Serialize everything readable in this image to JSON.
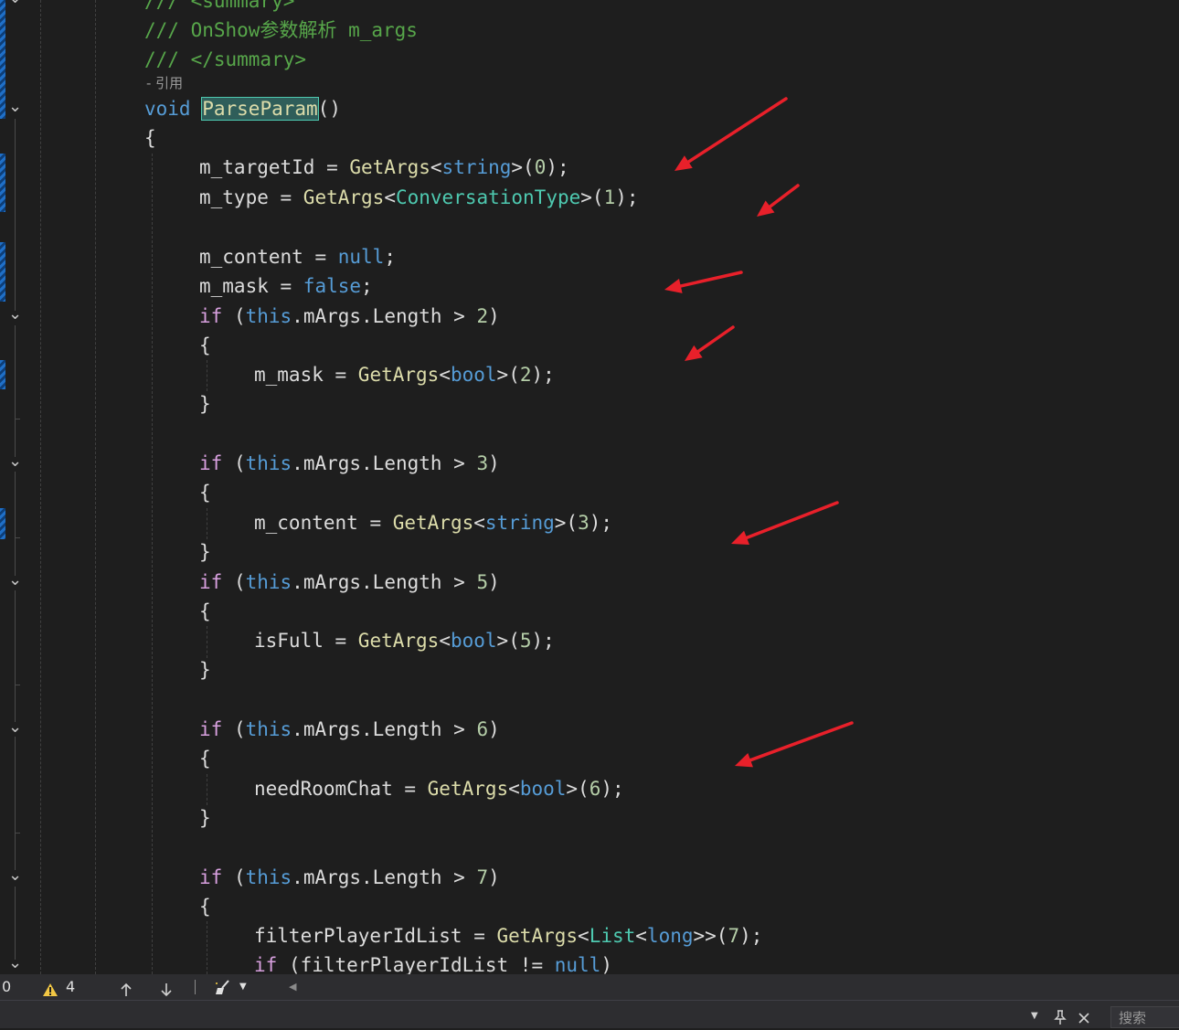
{
  "editor": {
    "codelens": "- 引用",
    "lines": [
      [
        [
          "k-comment",
          "/// <summary>"
        ]
      ],
      [
        [
          "k-comment",
          "/// OnShow参数解析 m_args"
        ]
      ],
      [
        [
          "k-comment",
          "/// </summary>"
        ]
      ],
      [
        [
          "k-keyword",
          "void"
        ],
        [
          "k-plain",
          " "
        ],
        [
          "k-hl",
          "ParseParam"
        ],
        [
          "k-plain",
          "()"
        ]
      ],
      [
        [
          "k-plain",
          "{"
        ]
      ],
      [
        [
          "k-var",
          "m_targetId"
        ],
        [
          "k-plain",
          " = "
        ],
        [
          "k-method",
          "GetArgs"
        ],
        [
          "k-plain",
          "<"
        ],
        [
          "k-keyword",
          "string"
        ],
        [
          "k-plain",
          ">("
        ],
        [
          "k-number",
          "0"
        ],
        [
          "k-plain",
          ");"
        ]
      ],
      [
        [
          "k-var",
          "m_type"
        ],
        [
          "k-plain",
          " = "
        ],
        [
          "k-method",
          "GetArgs"
        ],
        [
          "k-plain",
          "<"
        ],
        [
          "k-type",
          "ConversationType"
        ],
        [
          "k-plain",
          ">("
        ],
        [
          "k-number",
          "1"
        ],
        [
          "k-plain",
          ");"
        ]
      ],
      [],
      [
        [
          "k-var",
          "m_content"
        ],
        [
          "k-plain",
          " = "
        ],
        [
          "k-keyword",
          "null"
        ],
        [
          "k-plain",
          ";"
        ]
      ],
      [
        [
          "k-var",
          "m_mask"
        ],
        [
          "k-plain",
          " = "
        ],
        [
          "k-keyword",
          "false"
        ],
        [
          "k-plain",
          ";"
        ]
      ],
      [
        [
          "k-control",
          "if"
        ],
        [
          "k-plain",
          " ("
        ],
        [
          "k-keyword",
          "this"
        ],
        [
          "k-plain",
          ".mArgs.Length > "
        ],
        [
          "k-number",
          "2"
        ],
        [
          "k-plain",
          ")"
        ]
      ],
      [
        [
          "k-plain",
          "{"
        ]
      ],
      [
        [
          "k-var",
          "m_mask"
        ],
        [
          "k-plain",
          " = "
        ],
        [
          "k-method",
          "GetArgs"
        ],
        [
          "k-plain",
          "<"
        ],
        [
          "k-keyword",
          "bool"
        ],
        [
          "k-plain",
          ">("
        ],
        [
          "k-number",
          "2"
        ],
        [
          "k-plain",
          ");"
        ]
      ],
      [
        [
          "k-plain",
          "}"
        ]
      ],
      [],
      [
        [
          "k-control",
          "if"
        ],
        [
          "k-plain",
          " ("
        ],
        [
          "k-keyword",
          "this"
        ],
        [
          "k-plain",
          ".mArgs.Length > "
        ],
        [
          "k-number",
          "3"
        ],
        [
          "k-plain",
          ")"
        ]
      ],
      [
        [
          "k-plain",
          "{"
        ]
      ],
      [
        [
          "k-var",
          "m_content"
        ],
        [
          "k-plain",
          " = "
        ],
        [
          "k-method",
          "GetArgs"
        ],
        [
          "k-plain",
          "<"
        ],
        [
          "k-keyword",
          "string"
        ],
        [
          "k-plain",
          ">("
        ],
        [
          "k-number",
          "3"
        ],
        [
          "k-plain",
          ");"
        ]
      ],
      [
        [
          "k-plain",
          "}"
        ]
      ],
      [
        [
          "k-control",
          "if"
        ],
        [
          "k-plain",
          " ("
        ],
        [
          "k-keyword",
          "this"
        ],
        [
          "k-plain",
          ".mArgs.Length > "
        ],
        [
          "k-number",
          "5"
        ],
        [
          "k-plain",
          ")"
        ]
      ],
      [
        [
          "k-plain",
          "{"
        ]
      ],
      [
        [
          "k-var",
          "isFull"
        ],
        [
          "k-plain",
          " = "
        ],
        [
          "k-method",
          "GetArgs"
        ],
        [
          "k-plain",
          "<"
        ],
        [
          "k-keyword",
          "bool"
        ],
        [
          "k-plain",
          ">("
        ],
        [
          "k-number",
          "5"
        ],
        [
          "k-plain",
          ");"
        ]
      ],
      [
        [
          "k-plain",
          "}"
        ]
      ],
      [],
      [
        [
          "k-control",
          "if"
        ],
        [
          "k-plain",
          " ("
        ],
        [
          "k-keyword",
          "this"
        ],
        [
          "k-plain",
          ".mArgs.Length > "
        ],
        [
          "k-number",
          "6"
        ],
        [
          "k-plain",
          ")"
        ]
      ],
      [
        [
          "k-plain",
          "{"
        ]
      ],
      [
        [
          "k-var",
          "needRoomChat"
        ],
        [
          "k-plain",
          " = "
        ],
        [
          "k-method",
          "GetArgs"
        ],
        [
          "k-plain",
          "<"
        ],
        [
          "k-keyword",
          "bool"
        ],
        [
          "k-plain",
          ">("
        ],
        [
          "k-number",
          "6"
        ],
        [
          "k-plain",
          ");"
        ]
      ],
      [
        [
          "k-plain",
          "}"
        ]
      ],
      [],
      [
        [
          "k-control",
          "if"
        ],
        [
          "k-plain",
          " ("
        ],
        [
          "k-keyword",
          "this"
        ],
        [
          "k-plain",
          ".mArgs.Length > "
        ],
        [
          "k-number",
          "7"
        ],
        [
          "k-plain",
          ")"
        ]
      ],
      [
        [
          "k-plain",
          "{"
        ]
      ],
      [
        [
          "k-var",
          "filterPlayerIdList"
        ],
        [
          "k-plain",
          " = "
        ],
        [
          "k-method",
          "GetArgs"
        ],
        [
          "k-plain",
          "<"
        ],
        [
          "k-type",
          "List"
        ],
        [
          "k-plain",
          "<"
        ],
        [
          "k-keyword",
          "long"
        ],
        [
          "k-plain",
          ">>("
        ],
        [
          "k-number",
          "7"
        ],
        [
          "k-plain",
          ");"
        ]
      ],
      [
        [
          "k-control",
          "if"
        ],
        [
          "k-plain",
          " (filterPlayerIdList != "
        ],
        [
          "k-keyword",
          "null"
        ],
        [
          "k-plain",
          ")"
        ]
      ]
    ]
  },
  "colors": {
    "background": "#1e1e1e",
    "arrow": "#e8202a",
    "change_marker": "#1f6fc7"
  },
  "statusbar": {
    "errors": "0",
    "warning_icon": "warning-triangle-icon",
    "warnings": "4",
    "up_icon": "arrow-up-icon",
    "down_icon": "arrow-down-icon",
    "cleanup_icon": "code-cleanup-brush-icon",
    "scroll_left_icon": "scroll-left-icon"
  },
  "bottombar": {
    "search_placeholder": "搜索",
    "dropdown_icon": "chevron-down-icon",
    "pin_icon": "pin-icon",
    "close_icon": "close-icon"
  }
}
